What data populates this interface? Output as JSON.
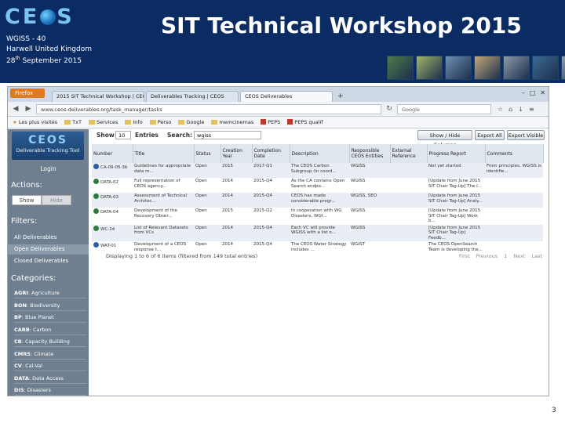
{
  "header": {
    "logo_text": "CEOS",
    "info_lines": [
      "WGISS - 40",
      "Harwell United Kingdom"
    ],
    "date_day": "28",
    "date_suffix": "th",
    "date_rest": " September 2015",
    "title": "SIT Technical Workshop 2015",
    "thumb_colors": [
      "#4f7a4a",
      "#a3b46c",
      "#6d8fb5",
      "#c2a77a",
      "#8a9aa8",
      "#3c6a93",
      "#8aa0b2",
      "#7c8a6a"
    ]
  },
  "browser": {
    "menu_label": "Firefox",
    "tabs": [
      {
        "label": "2015 SIT Technical Workshop | CEOS",
        "active": false
      },
      {
        "label": "Deliverables Tracking | CEOS",
        "active": false
      },
      {
        "label": "CEOS Deliverables",
        "active": true
      }
    ],
    "tab_close": "×",
    "new_tab": "+",
    "url": "www.ceos-deliverables.org/task_manager/tasks",
    "search_placeholder": "Google",
    "bookmarks": [
      {
        "label": "Les plus visités",
        "kind": "star"
      },
      {
        "label": "TxT",
        "kind": "folder"
      },
      {
        "label": "Services",
        "kind": "folder"
      },
      {
        "label": "Info",
        "kind": "folder"
      },
      {
        "label": "Perso",
        "kind": "folder"
      },
      {
        "label": "Google",
        "kind": "folder"
      },
      {
        "label": "memcinemas",
        "kind": "folder"
      },
      {
        "label": "PEPS",
        "kind": "red"
      },
      {
        "label": "PEPS qualif",
        "kind": "red"
      }
    ]
  },
  "sidebar": {
    "app_logo_line1": "CEOS",
    "app_logo_line2": "Deliverable Tracking Tool",
    "login": "Login",
    "actions_heading": "Actions:",
    "show_label": "Show",
    "hide_label": "Hide",
    "filters_heading": "Filters:",
    "filters": [
      {
        "label": "All Deliverables",
        "selected": false
      },
      {
        "label": "Open Deliverables",
        "selected": true
      },
      {
        "label": "Closed Deliverables",
        "selected": false
      }
    ],
    "categories_heading": "Categories:",
    "categories": [
      {
        "code": "AGRI",
        "name": ": Agriculture"
      },
      {
        "code": "BON",
        "name": ": Biodiversity"
      },
      {
        "code": "BP",
        "name": ": Blue Planet"
      },
      {
        "code": "CARB",
        "name": ": Carbon"
      },
      {
        "code": "CB",
        "name": ": Capacity Building"
      },
      {
        "code": "CMRS",
        "name": ": Climate"
      },
      {
        "code": "CV",
        "name": ": Cal-Val"
      },
      {
        "code": "DATA",
        "name": ": Data Access"
      },
      {
        "code": "DIS",
        "name": ": Disasters"
      }
    ]
  },
  "controls": {
    "show_label": "Show",
    "entries_value": "10",
    "entries_label": "Entries",
    "search_label": "Search:",
    "search_value": "wgiss",
    "btn_columns": "Show / Hide Columns",
    "btn_export_all": "Export All",
    "btn_export_visible": "Export Visible"
  },
  "table": {
    "columns": [
      "Number",
      "Title",
      "Status",
      "Creation Year",
      "Completion Date",
      "Description",
      "Responsible CEOS Entities",
      "External Reference",
      "Progress Report",
      "Comments"
    ],
    "rows": [
      {
        "number": "CA-09-05-3b",
        "title": "Guidelines for appropriate data m...",
        "status": "Open",
        "year": "2015",
        "completion": "2017-Q1",
        "description": "The CEOS Carbon Subgroup (in coord...",
        "entities": "WGISS",
        "external": "",
        "progress": "Not yet started",
        "comments": "From principles, WGISS is identifie...",
        "icon": "blue"
      },
      {
        "number": "DATA-02",
        "title": "Full representation of CEOS agency...",
        "status": "Open",
        "year": "2014",
        "completion": "2015-Q4",
        "description": "As the CA contains Open Search endpo...",
        "entities": "WGISS",
        "external": "",
        "progress": "[Update from June 2015 SIT Chair Tag-Up] The I...",
        "comments": "",
        "icon": "green"
      },
      {
        "number": "DATA-03",
        "title": "Assessment of Technical Architec...",
        "status": "Open",
        "year": "2014",
        "completion": "2015-Q4",
        "description": "CEOS has made considerable progr...",
        "entities": "WGISS, SEO",
        "external": "",
        "progress": "[Update from June 2015 SIT Chair Tag-Up] Analy...",
        "comments": "",
        "icon": "green"
      },
      {
        "number": "DATA-04",
        "title": "Development of the Recovery Obser...",
        "status": "Open",
        "year": "2015",
        "completion": "2015-Q2",
        "description": "In cooperation with WG Disasters, WGI...",
        "entities": "WGISS",
        "external": "",
        "progress": "[Update from June 2015 SIT Chair Tag-Up] Work b...",
        "comments": "",
        "icon": "green"
      },
      {
        "number": "WC-24",
        "title": "List of Relevant Datasets from VCs",
        "status": "Open",
        "year": "2014",
        "completion": "2015-Q4",
        "description": "Each VC will provide WGISS with a list o...",
        "entities": "WGISS",
        "external": "",
        "progress": "[Update from June 2015 SIT Chair Tag-Up] Feedb...",
        "comments": "",
        "icon": "green"
      },
      {
        "number": "WAT-01",
        "title": "Development of a CEOS response t...",
        "status": "Open",
        "year": "2014",
        "completion": "2015-Q4",
        "description": "The CEOS Water Strategy includes ...",
        "entities": "WGIST",
        "external": "",
        "progress": "The CEOS OpenSearch Team is developing the...",
        "comments": "",
        "icon": "blue"
      }
    ],
    "status_text": "Displaying 1 to 6 of 6 items (filtered from 149 total entries)",
    "pager": [
      "First",
      "Previous",
      "1",
      "Next",
      "Last"
    ]
  },
  "slide_number": "3"
}
